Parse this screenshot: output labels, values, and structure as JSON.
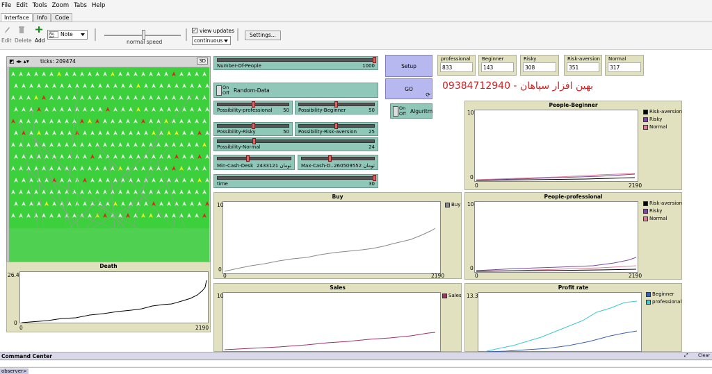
{
  "menu": [
    "File",
    "Edit",
    "Tools",
    "Zoom",
    "Tabs",
    "Help"
  ],
  "tabs": [
    "Interface",
    "Info",
    "Code"
  ],
  "toolbar": {
    "edit": "Edit",
    "delete": "Delete",
    "add": "Add",
    "note_select": "Note",
    "speed_label": "normal speed",
    "view_updates": "view updates",
    "update_mode": "continuous",
    "settings": "Settings..."
  },
  "view": {
    "ticks_label": "ticks: 209474",
    "three_d": "3D"
  },
  "sliders": {
    "number_of_people": {
      "name": "Number-Of-People",
      "value": "1000"
    },
    "poss_professional": {
      "name": "Possibility-professional",
      "value": "50"
    },
    "poss_beginner": {
      "name": "Possibility-Beginner",
      "value": "50"
    },
    "poss_risky": {
      "name": "Possibility-Risky",
      "value": "50"
    },
    "poss_risk_aversion": {
      "name": "Possibility-Risk-aversion",
      "value": "25"
    },
    "poss_normal": {
      "name": "Possibility-Normal",
      "value": "24"
    },
    "min_cash": {
      "name": "Min-Cash-Desk",
      "value": "2433121 تومان"
    },
    "max_cash": {
      "name": "Max-Cash-D...",
      "value": "260509552 تومان"
    },
    "time": {
      "name": "time",
      "value": "30"
    }
  },
  "switches": {
    "random_data": {
      "on": "On",
      "off": "Off",
      "name": "Random-Data"
    },
    "algorithm": {
      "on": "On",
      "off": "Off",
      "name": "Alguritm"
    }
  },
  "buttons": {
    "setup": "Setup",
    "go": "GO"
  },
  "monitors": [
    {
      "label": "professional",
      "value": "833"
    },
    {
      "label": "Beginner",
      "value": "143"
    },
    {
      "label": "Risky",
      "value": "308"
    },
    {
      "label": "Risk-aversion",
      "value": "351"
    },
    {
      "label": "Normal",
      "value": "317"
    }
  ],
  "banner": "بهین افزار سپاهان - 09384712940",
  "plots": {
    "death": {
      "title": "Death",
      "ymax": "26.4",
      "ymin": "0",
      "xmin": "0",
      "xmax": "2190"
    },
    "buy": {
      "title": "Buy",
      "ymax": "10",
      "ymin": "0",
      "xmin": "0",
      "xmax": "2190",
      "legend": [
        "Buy"
      ]
    },
    "sales": {
      "title": "Sales",
      "ymax": "10",
      "legend": [
        "Sales"
      ]
    },
    "people_beginner": {
      "title": "People-Beginner",
      "ymax": "10",
      "ymin": "0",
      "xmin": "0",
      "xmax": "2190",
      "legend": [
        "Risk-aversion",
        "Risky",
        "Normal"
      ]
    },
    "people_professional": {
      "title": "People-professional",
      "ymax": "10",
      "ymin": "0",
      "xmin": "0",
      "xmax": "2190",
      "legend": [
        "Risk-aversion",
        "Risky",
        "Normal"
      ]
    },
    "profit_rate": {
      "title": "Profit rate",
      "ymax": "13.3",
      "legend": [
        "Beginner",
        "professional"
      ]
    }
  },
  "colors": {
    "buy": "#888888",
    "sales": "#a0306a",
    "risk_aversion": "#000000",
    "risky": "#7a4aa0",
    "normal": "#e07898",
    "beginner": "#3a5fb0",
    "professional": "#3ec8d0",
    "death": "#000000"
  },
  "command_center": {
    "title": "Command Center",
    "clear": "Clear",
    "prompt": "observer>"
  }
}
